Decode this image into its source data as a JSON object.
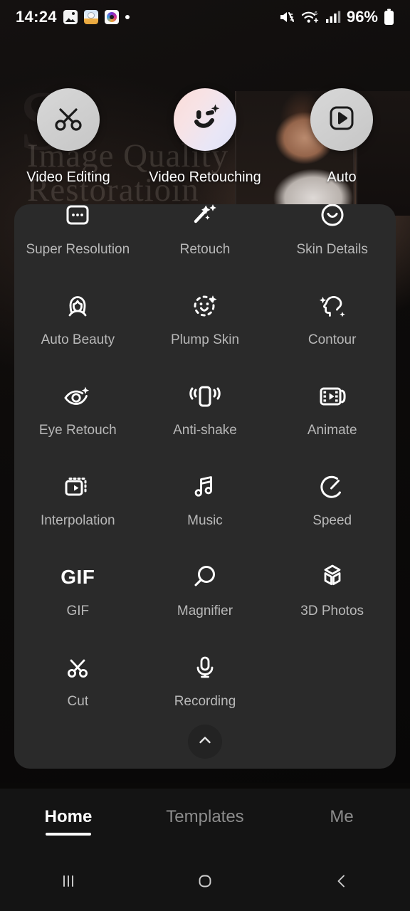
{
  "status_bar": {
    "time": "14:24",
    "battery_percent": "96%",
    "icons": [
      "gallery-app-icon",
      "photo-editor-app-icon",
      "camera-app-icon",
      "notification-dot",
      "mute-icon",
      "wifi-icon",
      "signal-icon",
      "battery-icon"
    ]
  },
  "hero": {
    "title_line1": "Image Quality",
    "title_line2": "Restoratioin",
    "watermark": "S"
  },
  "top_actions": [
    {
      "label": "Video Editing",
      "icon": "scissors-icon"
    },
    {
      "label": "Video Retouching",
      "icon": "winking-face-icon"
    },
    {
      "label": "Auto",
      "icon": "play-square-icon"
    }
  ],
  "tools": [
    {
      "label": "Super Resolution",
      "icon": "super-resolution-icon"
    },
    {
      "label": "Retouch",
      "icon": "magic-wand-icon"
    },
    {
      "label": "Skin Details",
      "icon": "face-circle-icon"
    },
    {
      "label": "Auto Beauty",
      "icon": "woman-portrait-icon"
    },
    {
      "label": "Plump Skin",
      "icon": "dashed-face-icon"
    },
    {
      "label": "Contour",
      "icon": "head-profile-icon"
    },
    {
      "label": "Eye Retouch",
      "icon": "eye-sparkle-icon"
    },
    {
      "label": "Anti-shake",
      "icon": "vibrate-phone-icon"
    },
    {
      "label": "Animate",
      "icon": "film-play-icon"
    },
    {
      "label": "Interpolation",
      "icon": "frames-play-icon"
    },
    {
      "label": "Music",
      "icon": "music-note-icon"
    },
    {
      "label": "Speed",
      "icon": "speedometer-icon"
    },
    {
      "label": "GIF",
      "icon": "gif-text-icon"
    },
    {
      "label": "Magnifier",
      "icon": "magnifier-icon"
    },
    {
      "label": "3D Photos",
      "icon": "cube-3d-icon"
    },
    {
      "label": "Cut",
      "icon": "scissors-cut-icon"
    },
    {
      "label": "Recording",
      "icon": "microphone-icon"
    }
  ],
  "collapse_button": {
    "icon": "chevron-up-icon"
  },
  "bottom_tabs": [
    {
      "label": "Home",
      "active": true
    },
    {
      "label": "Templates",
      "active": false
    },
    {
      "label": "Me",
      "active": false
    }
  ],
  "nav_bar": [
    {
      "icon": "recents-icon"
    },
    {
      "icon": "home-icon"
    },
    {
      "icon": "back-icon"
    }
  ],
  "colors": {
    "panel_bg": "#2a2a2a",
    "screen_bg": "#000000",
    "tab_bar_bg": "#141414",
    "label_gray": "#b8b8b8",
    "active_white": "#ffffff"
  }
}
